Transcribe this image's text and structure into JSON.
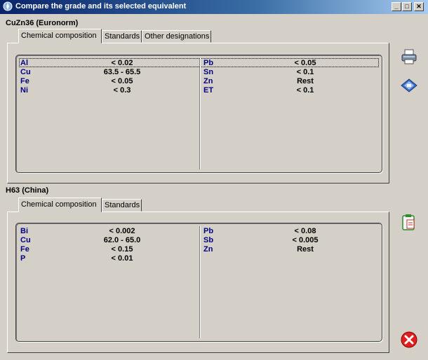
{
  "window": {
    "title": "Compare the grade and its selected equivalent"
  },
  "window_buttons": {
    "minimize": "_",
    "maximize": "□",
    "close": "✕"
  },
  "grade1": {
    "heading": "CuZn36 (Euronorm)",
    "tabs": [
      "Chemical composition",
      "Standards",
      "Other designations"
    ],
    "left": [
      {
        "element": "Al",
        "value": "< 0.02"
      },
      {
        "element": "Cu",
        "value": "63.5 - 65.5"
      },
      {
        "element": "Fe",
        "value": "< 0.05"
      },
      {
        "element": "Ni",
        "value": "< 0.3"
      }
    ],
    "right": [
      {
        "element": "Pb",
        "value": "< 0.05"
      },
      {
        "element": "Sn",
        "value": "< 0.1"
      },
      {
        "element": "Zn",
        "value": "Rest"
      },
      {
        "element": "ET",
        "value": "< 0.1"
      }
    ]
  },
  "grade2": {
    "heading": "H63 (China)",
    "tabs": [
      "Chemical composition",
      "Standards"
    ],
    "left": [
      {
        "element": "Bi",
        "value": "< 0.002"
      },
      {
        "element": "Cu",
        "value": "62.0 - 65.0"
      },
      {
        "element": "Fe",
        "value": "< 0.15"
      },
      {
        "element": "P",
        "value": "< 0.01"
      }
    ],
    "right": [
      {
        "element": "Pb",
        "value": "< 0.08"
      },
      {
        "element": "Sb",
        "value": "< 0.005"
      },
      {
        "element": "Zn",
        "value": "Rest"
      }
    ]
  },
  "icons": {
    "print": "printer-icon",
    "export": "diskette-icon",
    "copy": "clipboard-icon",
    "close": "close-circle-icon"
  },
  "colors": {
    "titlebar": "#0a246a",
    "element_text": "#000080",
    "close_red": "#e02020"
  }
}
